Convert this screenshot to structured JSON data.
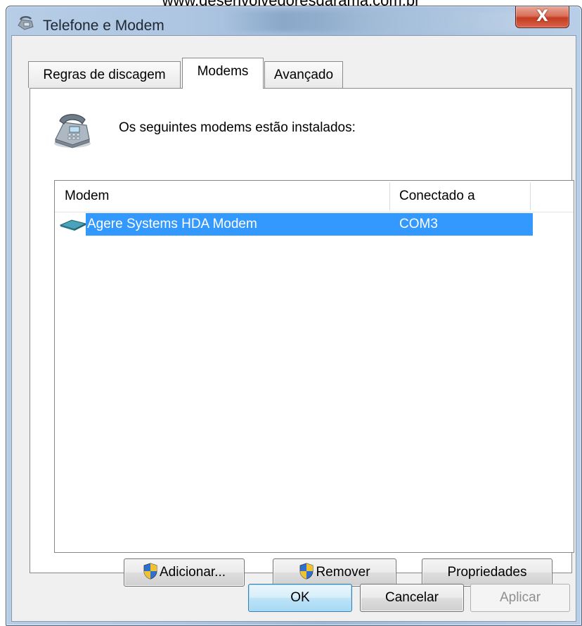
{
  "watermark": "www.desenvolvedoresdarama.com.br",
  "window": {
    "title": "Telefone e Modem",
    "close_label": "X"
  },
  "tabs": [
    {
      "label": "Regras de discagem",
      "active": false
    },
    {
      "label": "Modems",
      "active": true
    },
    {
      "label": "Avançado",
      "active": false
    }
  ],
  "modems_tab": {
    "installed_label": "Os seguintes modems estão instalados:",
    "columns": [
      "Modem",
      "Conectado a"
    ],
    "rows": [
      {
        "modem": "Agere Systems HDA Modem",
        "port": "COM3",
        "selected": true,
        "icon": "modem-icon"
      }
    ],
    "buttons": {
      "add": "Adicionar...",
      "remove": "Remover",
      "properties": "Propriedades"
    }
  },
  "footer": {
    "ok": "OK",
    "cancel": "Cancelar",
    "apply": "Aplicar"
  },
  "colors": {
    "selection": "#3399ff",
    "close_button": "#c33c20",
    "window_frame": "#aec6e2"
  }
}
